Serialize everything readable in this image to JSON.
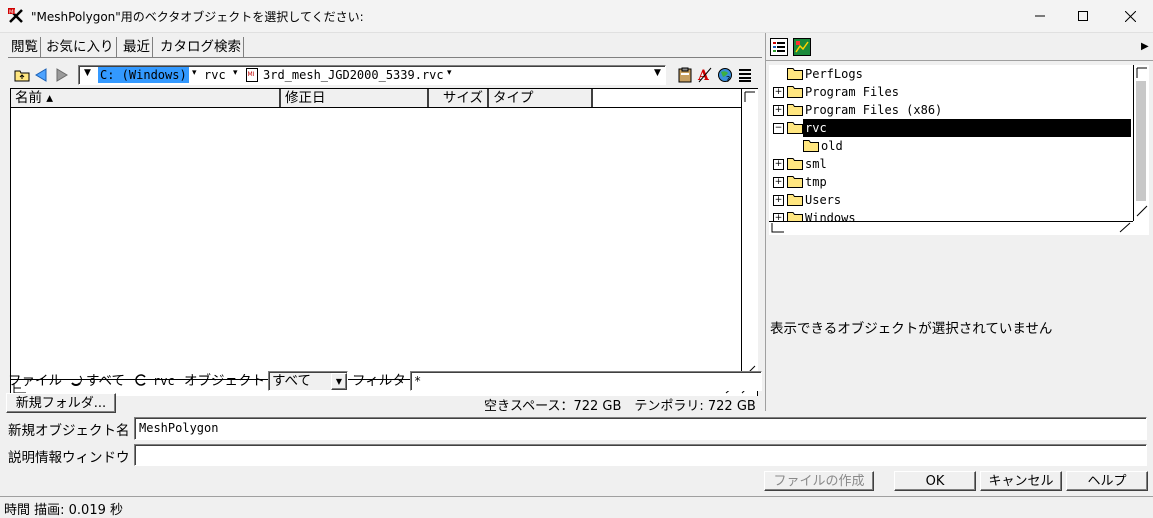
{
  "window": {
    "title": "\"MeshPolygon\"用のベクタオブジェクトを選択してください:",
    "minimize_icon": "minimize-icon",
    "maximize_icon": "maximize-icon",
    "close_icon": "close-icon"
  },
  "tabs": [
    "閲覧",
    "お気に入り",
    "最近",
    "カタログ検索"
  ],
  "path_bar": {
    "drive": "C: (Windows)",
    "folder": "rvc",
    "file": "3rd_mesh_JGD2000_5339.rvc"
  },
  "file_list": {
    "columns": [
      "名前 ▴",
      "修正日",
      "サイズ",
      "タイプ"
    ],
    "rows": []
  },
  "tree": {
    "items": [
      {
        "label": "PerfLogs",
        "expander": ""
      },
      {
        "label": "Program Files",
        "expander": "+"
      },
      {
        "label": "Program Files (x86)",
        "expander": "+"
      },
      {
        "label": "rvc",
        "expander": "−"
      },
      {
        "label": "old",
        "expander": ""
      },
      {
        "label": "sml",
        "expander": "+"
      },
      {
        "label": "tmp",
        "expander": "+"
      },
      {
        "label": "Users",
        "expander": "+"
      },
      {
        "label": "Windows",
        "expander": "+"
      }
    ],
    "selected": "rvc"
  },
  "no_selection_message": "表示できるオブジェクトが選択されていません",
  "filter_row": {
    "file_label": "ファイル",
    "all_option": "すべて",
    "rvc_option": "rvc",
    "object_label": "オブジェクト",
    "object_value": "すべて",
    "filter_label": "フィルタ",
    "filter_value": "*"
  },
  "new_folder_button": "新規フォルダ...",
  "space_info": "空きスペース：722 GB　テンポラリ: 722 GB",
  "new_object": {
    "label": "新規オブジェクト名",
    "value": "MeshPolygon"
  },
  "description": {
    "label": "説明情報ウィンドウ",
    "value": ""
  },
  "buttons": {
    "create_file": "ファイルの作成",
    "ok": "OK",
    "cancel": "キャンセル",
    "help": "ヘルプ"
  },
  "status_bar": "時間 描画: 0.019 秒",
  "colors": {
    "selection": "#000000",
    "drive_highlight": "#3399ff",
    "disabled_text": "#8a8a8a"
  }
}
